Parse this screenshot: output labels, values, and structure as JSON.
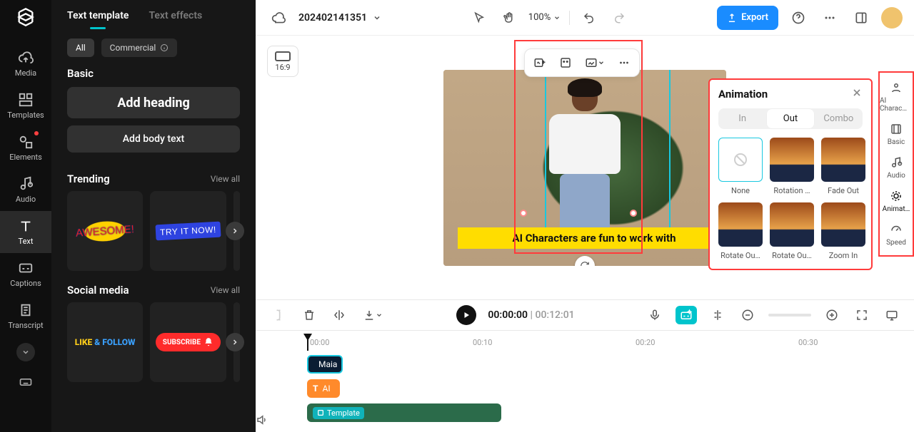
{
  "nav": {
    "items": [
      {
        "label": "Media"
      },
      {
        "label": "Templates"
      },
      {
        "label": "Elements"
      },
      {
        "label": "Audio"
      },
      {
        "label": "Text"
      },
      {
        "label": "Captions"
      },
      {
        "label": "Transcript"
      }
    ]
  },
  "left_panel": {
    "tabs": {
      "template": "Text template",
      "effects": "Text effects"
    },
    "chips": {
      "all": "All",
      "commercial": "Commercial"
    },
    "basic": {
      "title": "Basic",
      "add_heading": "Add heading",
      "add_body": "Add body text"
    },
    "trending": {
      "title": "Trending",
      "view_all": "View all",
      "tiles": [
        "AWESOME!",
        "TRY IT NOW!"
      ]
    },
    "social": {
      "title": "Social media",
      "view_all": "View all",
      "tiles": [
        {
          "like": "LIKE",
          "follow": " & FOLLOW"
        },
        {
          "subscribe": "SUBSCRIBE"
        }
      ]
    }
  },
  "topbar": {
    "project_name": "202402141351",
    "zoom": "100%",
    "export": "Export"
  },
  "canvas": {
    "aspect": "16:9",
    "caption": "AI Characters are fun to work with"
  },
  "animation": {
    "title": "Animation",
    "tabs": {
      "in": "In",
      "out": "Out",
      "combo": "Combo"
    },
    "items": [
      "None",
      "Rotation …",
      "Fade Out",
      "Rotate Ou…",
      "Rotate Ou…",
      "Zoom In"
    ]
  },
  "right_rail": {
    "items": [
      "AI Charac…",
      "Basic",
      "Audio",
      "Animat…",
      "Speed"
    ]
  },
  "mid_toolbar": {
    "current": "00:00:00",
    "duration": "00:12:01"
  },
  "timeline": {
    "ticks": [
      "00:00",
      "00:10",
      "00:20",
      "00:30"
    ],
    "clips": {
      "maia": "Maia",
      "text": "AI",
      "video_badge": "Template"
    }
  }
}
